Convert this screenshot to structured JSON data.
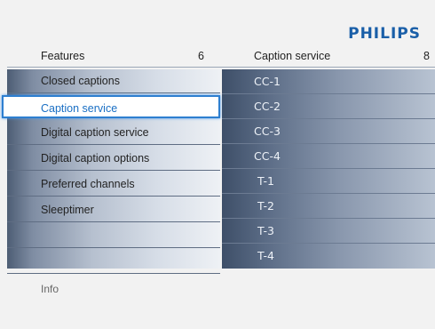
{
  "brand": "PHILIPS",
  "left_header": {
    "label": "Features",
    "count": "6"
  },
  "right_header": {
    "label": "Caption service",
    "count": "8"
  },
  "left_items": [
    {
      "label": "Closed captions",
      "selected": false
    },
    {
      "label": "Caption service",
      "selected": true
    },
    {
      "label": "Digital caption service",
      "selected": false
    },
    {
      "label": "Digital caption options",
      "selected": false
    },
    {
      "label": "Preferred channels",
      "selected": false
    },
    {
      "label": "Sleeptimer",
      "selected": false
    },
    {
      "label": "",
      "selected": false
    },
    {
      "label": "",
      "selected": false
    }
  ],
  "right_items": [
    {
      "label": "CC-1"
    },
    {
      "label": "CC-2"
    },
    {
      "label": "CC-3"
    },
    {
      "label": "CC-4"
    },
    {
      "label": "T-1"
    },
    {
      "label": "T-2"
    },
    {
      "label": "T-3"
    },
    {
      "label": "T-4"
    }
  ],
  "info": "Info",
  "colors": {
    "brand": "#1a5fa8",
    "highlight_border": "#2e7fd0",
    "highlight_text": "#1a6fc4"
  }
}
